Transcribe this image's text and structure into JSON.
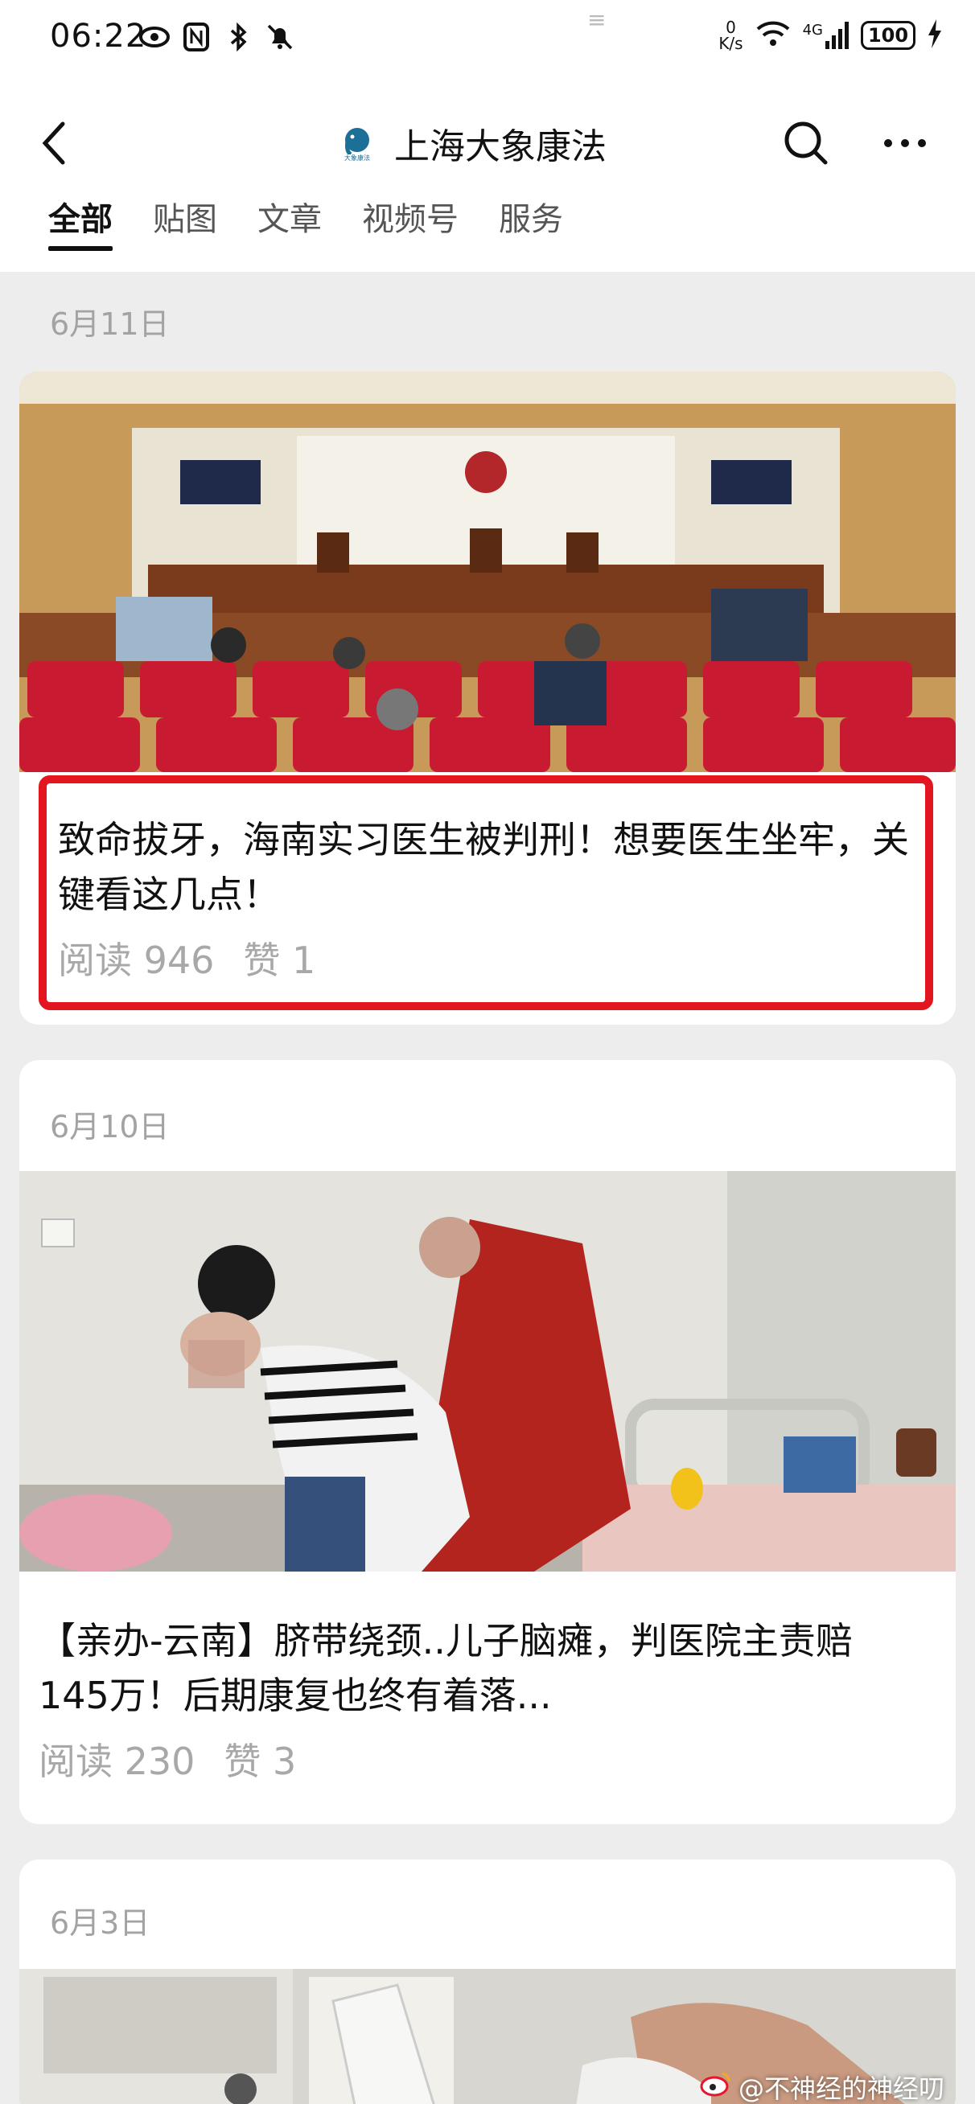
{
  "status_bar": {
    "time": "06:22",
    "net_speed_value": "0",
    "net_speed_unit": "K/s",
    "network": "4G",
    "battery": "100"
  },
  "header": {
    "title": "上海大象康法",
    "logo_text": "大象康法"
  },
  "tabs": [
    {
      "label": "全部",
      "active": true
    },
    {
      "label": "贴图",
      "active": false
    },
    {
      "label": "文章",
      "active": false
    },
    {
      "label": "视频号",
      "active": false
    },
    {
      "label": "服务",
      "active": false
    }
  ],
  "posts": [
    {
      "date": "6月11日",
      "title": "致命拔牙，海南实习医生被判刑！想要医生坐牢，关键看这几点！",
      "reads": "阅读 946",
      "likes": "赞 1",
      "highlighted": true
    },
    {
      "date": "6月10日",
      "title": "【亲办-云南】脐带绕颈..儿子脑瘫，判医院主责赔145万！后期康复也终有着落...",
      "reads": "阅读 230",
      "likes": "赞 3",
      "highlighted": false
    },
    {
      "date": "6月3日"
    }
  ],
  "watermark": "@不神经的神经叨",
  "colors": {
    "highlight": "#e3161f",
    "background": "#ededed",
    "muted_text": "#a8a8a8"
  }
}
